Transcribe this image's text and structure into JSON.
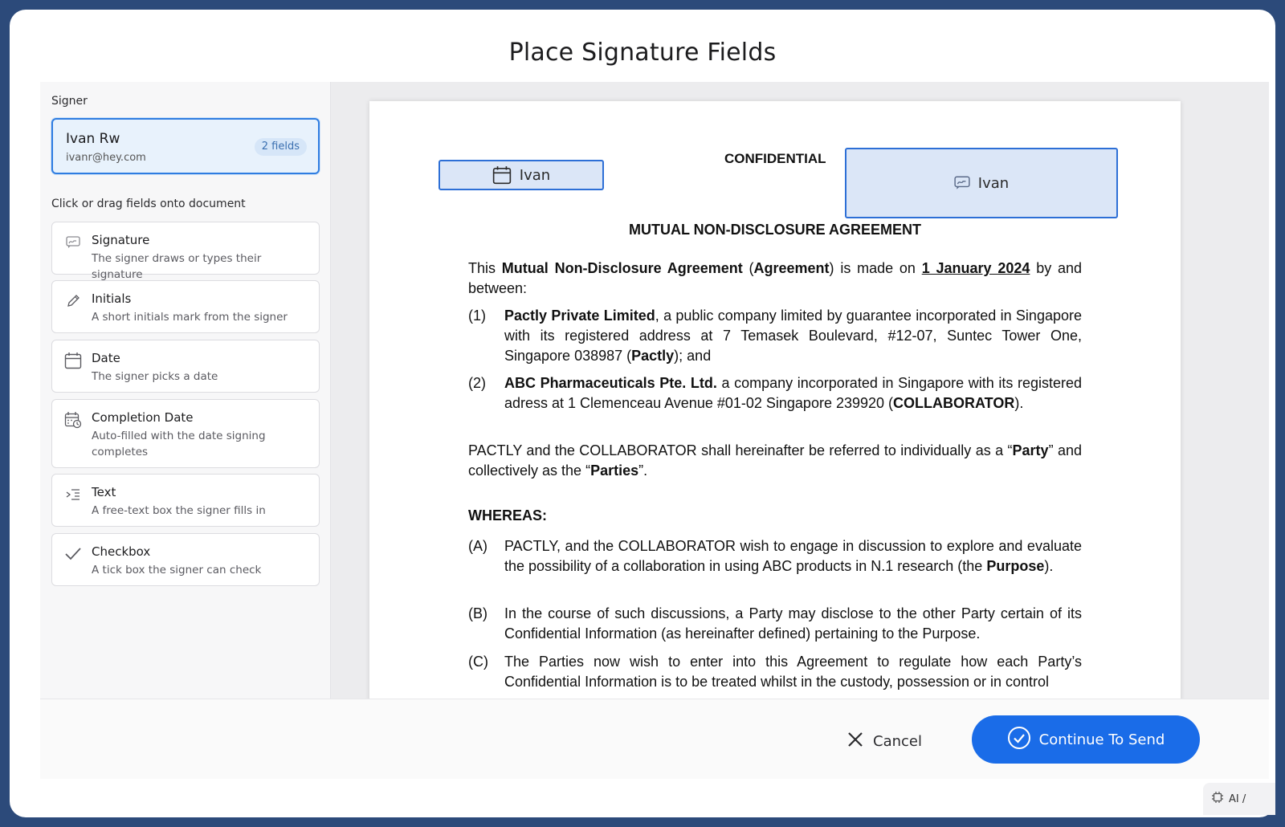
{
  "modal": {
    "title": "Place Signature Fields"
  },
  "sidebar": {
    "signer_label": "Signer",
    "signer": {
      "name": "Ivan Rw",
      "email": "ivanr@hey.com",
      "badge": "2 fields"
    },
    "instructions": "Click or drag fields onto document",
    "fields": [
      {
        "name": "Signature",
        "desc": "The signer draws or types their signature",
        "icon": "signature-icon"
      },
      {
        "name": "Initials",
        "desc": "A short initials mark from the signer",
        "icon": "pencil-icon"
      },
      {
        "name": "Date",
        "desc": "The signer picks a date",
        "icon": "calendar-icon"
      },
      {
        "name": "Completion Date",
        "desc": "Auto-filled with the date signing completes",
        "icon": "calendar-clock-icon"
      },
      {
        "name": "Text",
        "desc": "A free-text box the signer fills in",
        "icon": "text-lines-icon"
      },
      {
        "name": "Checkbox",
        "desc": "A tick box the signer can check",
        "icon": "checkmark-icon"
      }
    ]
  },
  "document": {
    "placed_fields": {
      "date_field": {
        "label": "Ivan",
        "icon": "calendar-icon"
      },
      "signature_field": {
        "label": "Ivan",
        "icon": "signature-icon"
      }
    },
    "confidential": "CONFIDENTIAL",
    "title": "MUTUAL NON-DISCLOSURE AGREEMENT",
    "intro": {
      "t1": "This ",
      "b1": "Mutual Non-Disclosure Agreement",
      "t2": " (",
      "b2": "Agreement",
      "t3": ") is made on ",
      "date": "1 January 2024",
      "t4": " by and between:"
    },
    "party1": {
      "num": "(1)",
      "name": "Pactly Private Limited",
      "text": ", a public company limited by guarantee incorporated in Singapore with its registered address at 7 Temasek Boulevard, #12-07, Suntec Tower One, Singapore 038987 (",
      "short": "Pactly",
      "end": "); and"
    },
    "party2": {
      "num": "(2)",
      "name": "ABC Pharmaceuticals Pte. Ltd.",
      "text": " a company incorporated in Singapore with its registered adress at 1 Clemenceau Avenue #01-02 Singapore 239920 (",
      "short": "COLLABORATOR",
      "end": ")."
    },
    "parties": {
      "t1": "PACTLY and the COLLABORATOR shall hereinafter be referred to individually as a “",
      "b1": "Party",
      "t2": "” and collectively as the “",
      "b2": "Parties",
      "t3": "”."
    },
    "whereas": "WHEREAS:",
    "recitals": {
      "a": {
        "num": "(A)",
        "text": "PACTLY, and the COLLABORATOR wish to engage in discussion to explore and evaluate the possibility of a collaboration in using ABC products in N.1 research (the ",
        "bold": "Purpose",
        "end": ")."
      },
      "b": {
        "num": "(B)",
        "text": "In the course of such discussions, a Party may disclose to the other Party certain of its Confidential Information (as hereinafter defined) pertaining to the Purpose."
      },
      "c": {
        "num": "(C)",
        "text": "The Parties now wish to enter into this Agreement to regulate how each Party’s Confidential Information is to be treated whilst in the custody, possession or in control"
      }
    }
  },
  "footer": {
    "cancel_label": "Cancel",
    "continue_label": "Continue To Send"
  },
  "corner": {
    "label": "AI /"
  },
  "colors": {
    "accent": "#1a6ce8",
    "field_border": "#2d6fd6",
    "field_fill": "#dbe6f7"
  }
}
